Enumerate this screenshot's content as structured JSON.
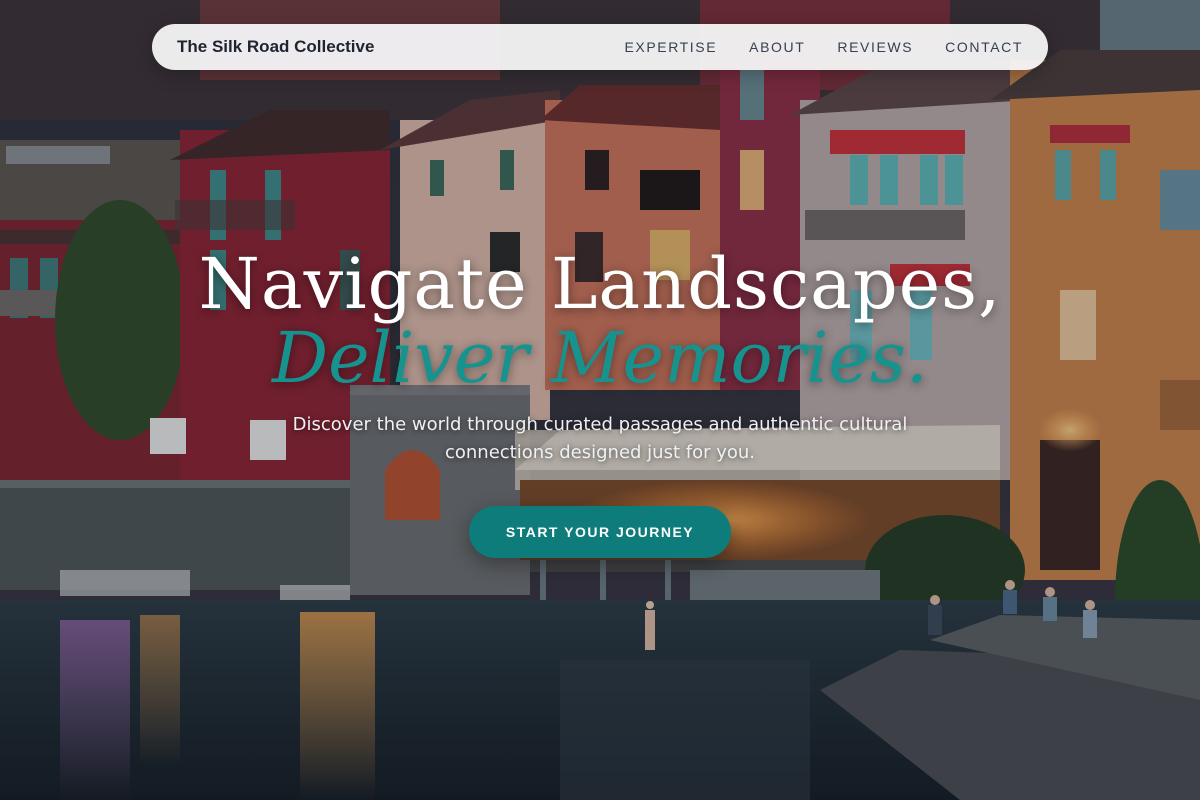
{
  "brand": {
    "name": "The Silk Road Collective"
  },
  "nav": {
    "items": [
      {
        "label": "EXPERTISE"
      },
      {
        "label": "ABOUT"
      },
      {
        "label": "REVIEWS"
      },
      {
        "label": "CONTACT"
      }
    ]
  },
  "hero": {
    "headline_line1": "Navigate Landscapes,",
    "headline_line2": "Deliver Memories.",
    "subtitle_line1": "Discover the world through curated passages and authentic cultural",
    "subtitle_line2": "connections designed just for you.",
    "cta_label": "START YOUR JOURNEY",
    "background_image": "lakeside-town-at-dusk"
  },
  "colors": {
    "accent": "#0e7c7a",
    "headline_accent": "#17938f",
    "navbar_bg": "#f5f5f7",
    "brand_text": "#1f2430"
  }
}
